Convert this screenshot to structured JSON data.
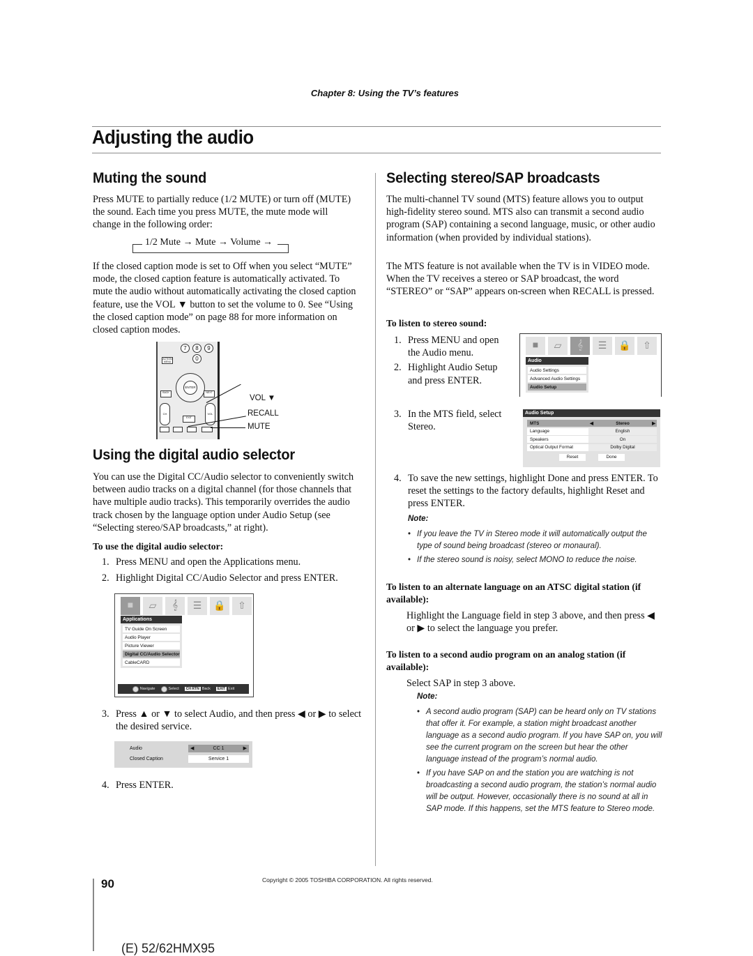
{
  "header": {
    "chapter": "Chapter 8: Using the TV’s features",
    "page_title": "Adjusting the audio"
  },
  "muting": {
    "heading": "Muting the sound",
    "intro": "Press MUTE to partially reduce (1/2 MUTE) or turn off (MUTE) the sound. Each time you press MUTE, the mute mode will change in the following order:",
    "cycle": "1/2 Mute → Mute → Volume →",
    "body": "If the closed caption mode is set to Off when you select “MUTE” mode, the closed caption feature is automatically activated. To mute the audio without automatically activating the closed caption feature, use the VOL ▼ button to set the volume to 0. See “Using the closed caption mode” on page 88 for more information on closed caption modes.",
    "remote_callouts": [
      "VOL ▼",
      "RECALL",
      "MUTE"
    ],
    "remote_keys": {
      "digits": [
        "7",
        "8",
        "9",
        "0"
      ],
      "enter": "ENTER",
      "exit": "EXIT",
      "action": "ACTION MENU",
      "back": "BACK",
      "next": "NEXT",
      "ch": "CH",
      "vol": "VOL"
    }
  },
  "digital_selector": {
    "heading": "Using the digital audio selector",
    "body": "You can use the Digital CC/Audio selector to conveniently switch between audio tracks on a digital channel (for those channels that have multiple audio tracks). This temporarily overrides the audio track chosen by the language option under Audio Setup (see “Selecting stereo/SAP broadcasts,” at right).",
    "subheading": "To use the digital audio selector:",
    "steps": [
      {
        "num": "1.",
        "text": "Press MENU and open the Applications menu."
      },
      {
        "num": "2.",
        "text": "Highlight Digital CC/Audio Selector and press ENTER."
      },
      {
        "num": "3.",
        "text": "Press ▲ or ▼ to select Audio, and then press ◀ or ▶ to select the desired service."
      },
      {
        "num": "4.",
        "text": "Press ENTER."
      }
    ],
    "applications_menu": {
      "title": "Applications",
      "items": [
        "TV Guide On Screen",
        "Audio Player",
        "Picture Viewer",
        "Digital CC/Audio Selector",
        "CableCARD"
      ],
      "selected_index": 3,
      "navbar": [
        {
          "key": "",
          "label": "Navigate"
        },
        {
          "key": "",
          "label": "Select"
        },
        {
          "key": "CH RTN",
          "label": "Back"
        },
        {
          "key": "EXIT",
          "label": "Exit"
        }
      ]
    },
    "selector_panel": {
      "rows": [
        {
          "label": "Audio",
          "value": "CC 1",
          "arrows": true
        },
        {
          "label": "Closed Caption",
          "value": "Service 1",
          "arrows": false
        }
      ]
    }
  },
  "stereo_sap": {
    "heading": "Selecting stereo/SAP broadcasts",
    "p1": "The multi-channel TV sound (MTS) feature allows you to output high-fidelity stereo sound. MTS also can transmit a second audio program (SAP) containing a second language, music, or other audio information (when provided by individual stations).",
    "p2": "The MTS feature is not available when the TV is in VIDEO mode. When the TV receives a stereo or SAP broadcast, the word “STEREO” or “SAP” appears on-screen when RECALL is pressed.",
    "subheading": "To listen to stereo sound:",
    "steps": [
      {
        "num": "1.",
        "text": "Press MENU and open the Audio menu."
      },
      {
        "num": "2.",
        "text": "Highlight Audio Setup and press ENTER."
      },
      {
        "num": "3.",
        "text": "In the MTS field, select Stereo."
      },
      {
        "num": "4.",
        "text": "To save the new settings, highlight Done and press ENTER. To reset the settings to the factory defaults, highlight Reset and press ENTER."
      }
    ],
    "audio_menu": {
      "title": "Audio",
      "items": [
        "Audio Settings",
        "Advanced Audio Settings",
        "Audio Setup"
      ],
      "selected_index": 2
    },
    "audio_setup": {
      "title": "Audio Setup",
      "rows": [
        {
          "label": "MTS",
          "value": "Stereo",
          "arrows": true
        },
        {
          "label": "Language",
          "value": "English",
          "arrows": false
        },
        {
          "label": "Speakers",
          "value": "On",
          "arrows": false
        },
        {
          "label": "Optical Output Format",
          "value": "Dolby Digital",
          "arrows": false
        }
      ],
      "buttons": [
        "Reset",
        "Done"
      ]
    },
    "note1": {
      "label": "Note:",
      "items": [
        "If you leave the TV in Stereo mode it will automatically output the type of sound being broadcast (stereo or monaural).",
        "If the stereo sound is noisy, select MONO to reduce the noise."
      ]
    },
    "atsc_heading": "To listen to an alternate language on an ATSC digital station (if available):",
    "atsc_text": "Highlight the Language field in step 3 above, and then press ◀ or ▶ to select the language you prefer.",
    "analog_heading": "To listen to a second audio program on an analog station (if available):",
    "analog_text": "Select SAP in step 3 above.",
    "note2": {
      "label": "Note:",
      "items": [
        "A second audio program (SAP) can be heard only on TV stations that offer it. For example, a station might broadcast another language as a second audio program. If you have SAP on, you will see the current program on the screen but hear the other language instead of the program’s normal audio.",
        "If you have SAP on and the station you are watching is not broadcasting a second audio program, the station’s normal audio will be output. However, occasionally there is no sound at all in SAP mode. If this happens, set the MTS feature to Stereo mode."
      ]
    }
  },
  "footer": {
    "page_number": "90",
    "copyright": "Copyright © 2005 TOSHIBA CORPORATION. All rights reserved.",
    "model": "(E) 52/62HMX95"
  },
  "menu_icons": [
    "applications-icon",
    "picture-icon",
    "audio-icon",
    "settings-icon",
    "lock-icon",
    "setup-icon"
  ]
}
